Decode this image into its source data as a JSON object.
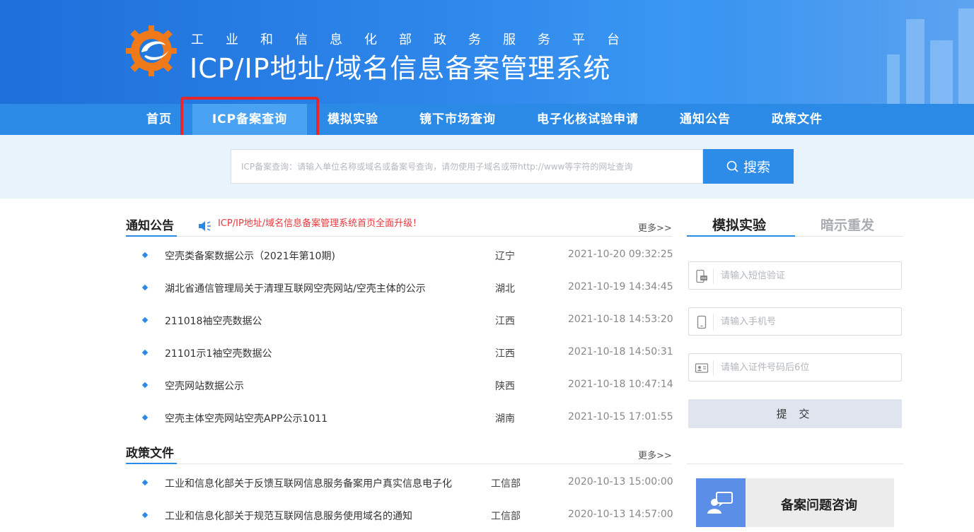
{
  "header": {
    "subtitle": "工业和信息化部政务服务平台",
    "title": "ICP/IP地址/域名信息备案管理系统"
  },
  "nav": {
    "items": [
      {
        "label": "首页"
      },
      {
        "label": "ICP备案查询",
        "active": true
      },
      {
        "label": "模拟实验"
      },
      {
        "label": "镜下市场查询"
      },
      {
        "label": "电子化核试验申请"
      },
      {
        "label": "通知公告"
      },
      {
        "label": "政策文件"
      }
    ]
  },
  "search": {
    "placeholder": "ICP备案查询：请输入单位名称或域名或备案号查询，请勿使用子域名或带http://www等字符的网址查询",
    "button_label": "搜索"
  },
  "notices": {
    "title": "通知公告",
    "banner_text": "ICP/IP地址/域名信息备案管理系统首页全面升级！",
    "more": "更多>>",
    "items": [
      {
        "title": "空壳类备案数据公示（2021年第10期)",
        "region": "辽宁",
        "date": "2021-10-20 09:32:25"
      },
      {
        "title": "湖北省通信管理局关于清理互联网空壳网站/空壳主体的公示",
        "region": "湖北",
        "date": "2021-10-19 14:34:45"
      },
      {
        "title": "211018袖空壳数据公",
        "region": "江西",
        "date": "2021-10-18 14:53:20"
      },
      {
        "title": "21101示1袖空壳数据公",
        "region": "江西",
        "date": "2021-10-18 14:50:31"
      },
      {
        "title": "空壳网站数据公示",
        "region": "陕西",
        "date": "2021-10-18 10:47:14"
      },
      {
        "title": "空壳主体空壳网站空壳APP公示1011",
        "region": "湖南",
        "date": "2021-10-15 17:01:55"
      }
    ]
  },
  "policies": {
    "title": "政策文件",
    "more": "更多>>",
    "items": [
      {
        "title": "工业和信息化部关于反馈互联网信息服务备案用户真实信息电子化",
        "region": "工信部",
        "date": "2020-10-13 15:00:00"
      },
      {
        "title": "工业和信息化部关于规范互联网信息服务使用域名的通知",
        "region": "工信部",
        "date": "2020-10-13 14:57:00"
      }
    ]
  },
  "side": {
    "tabs": [
      {
        "label": "模拟实验",
        "active": true
      },
      {
        "label": "暗示重发"
      }
    ],
    "fields": {
      "sms_placeholder": "请输入短信验证",
      "phone_placeholder": "请输入手机号",
      "id_placeholder": "请输入证件号码后6位"
    },
    "submit_label": "提 交",
    "consult_label": "备案问题咨询"
  },
  "colors": {
    "brand_blue": "#2b8ae6",
    "highlight_red": "#e8262a",
    "notice_red": "#e8383d"
  }
}
